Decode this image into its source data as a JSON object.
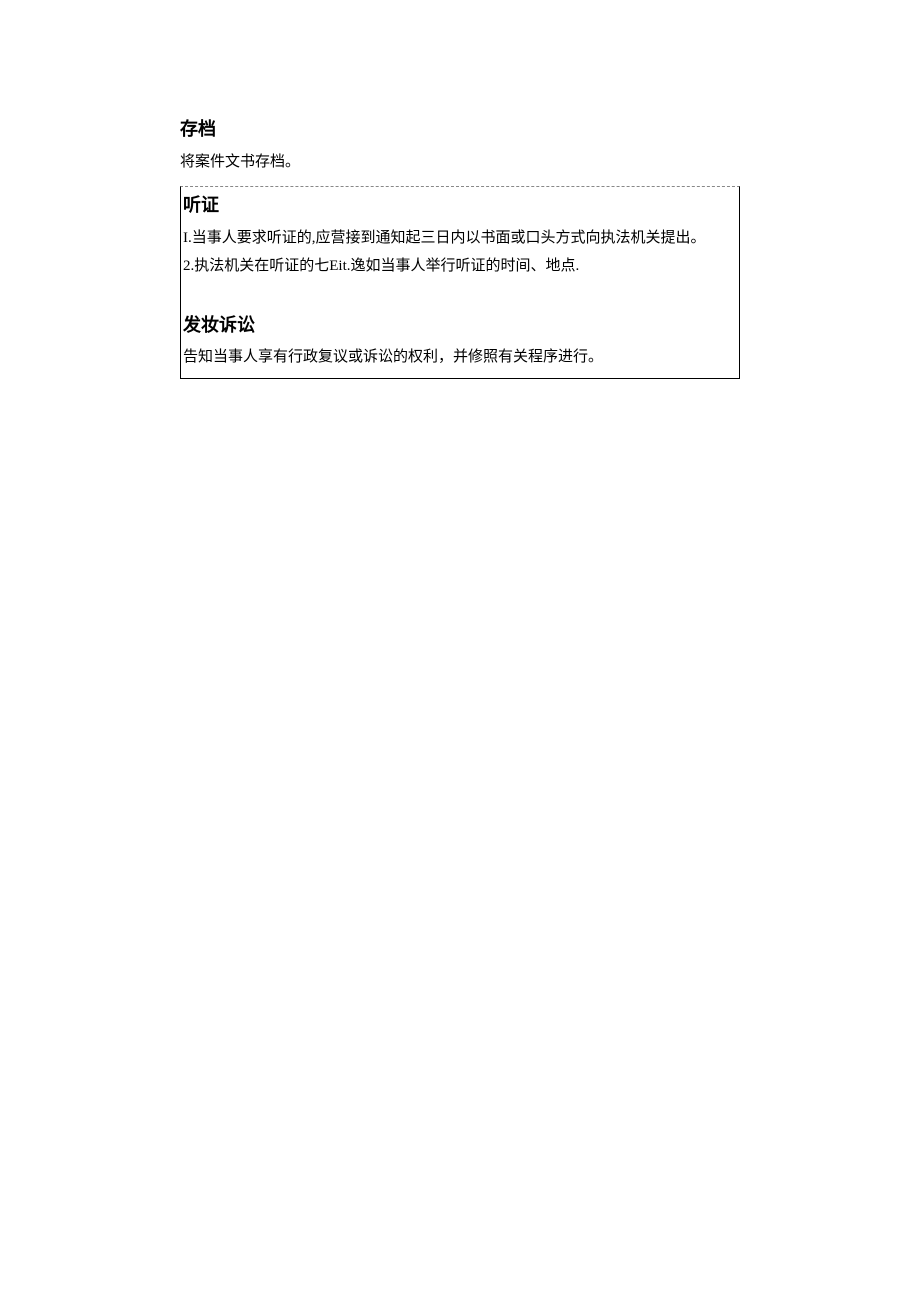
{
  "section1": {
    "heading": "存档",
    "body": "将案件文书存档。"
  },
  "box": {
    "section2": {
      "heading": "听证",
      "line1": "I.当事人要求听证的,应营接到通知起三日内以书面或口头方式向执法机关提出。",
      "line2": "2.执法机关在听证的七Eit.逸如当事人举行听证的时间、地点."
    },
    "section3": {
      "heading": "发妆诉讼",
      "body": "告知当事人享有行政复议或诉讼的权利，并修照有关程序进行。"
    }
  }
}
